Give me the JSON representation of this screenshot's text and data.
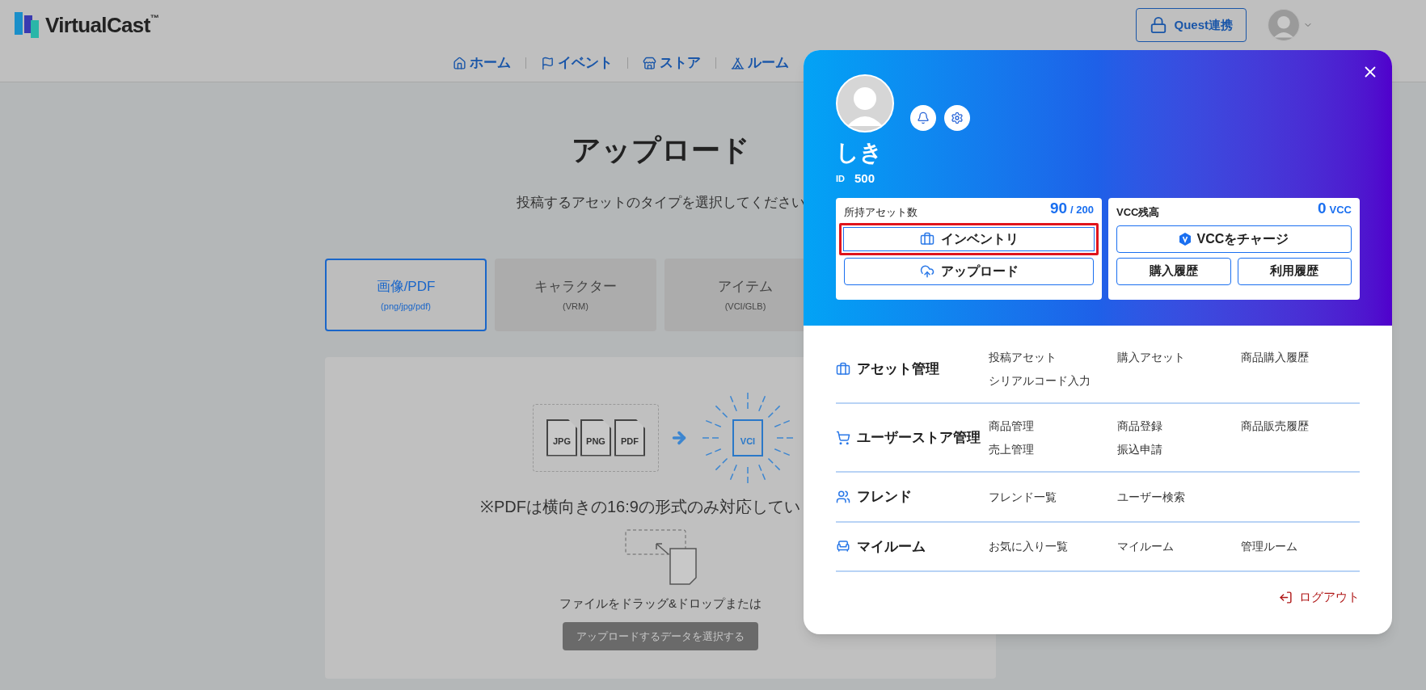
{
  "header": {
    "logo": "VirtualCast",
    "logo_mark": "™",
    "quest_button": "Quest連携",
    "nav": [
      "ホーム",
      "イベント",
      "ストア",
      "ルーム"
    ]
  },
  "page": {
    "title": "アップロード",
    "subtitle": "投稿するアセットのタイプを選択してください",
    "types": [
      {
        "label": "画像/PDF",
        "formats": "(png/jpg/pdf)",
        "selected": true
      },
      {
        "label": "キャラクター",
        "formats": "(VRM)",
        "selected": false
      },
      {
        "label": "アイテム",
        "formats": "(VCI/GLB)",
        "selected": false
      }
    ],
    "files": [
      "JPG",
      "PNG",
      "PDF"
    ],
    "target": "VCI",
    "note": "※PDFは横向きの16:9の形式のみ対応してい",
    "drop_text": "ファイルをドラッグ&ドロップまたは",
    "select_button": "アップロードするデータを選択する"
  },
  "menu": {
    "user_name": "しき",
    "id_label": "ID",
    "id": "500",
    "assets": {
      "label": "所持アセット数",
      "count": "90",
      "limit": "/ 200",
      "buttons": [
        {
          "label": "インベントリ",
          "highlighted": true
        },
        {
          "label": "アップロード",
          "highlighted": false
        }
      ]
    },
    "vcc": {
      "label": "VCC残高",
      "amount": "0",
      "unit": "VCC",
      "charge": "VCCをチャージ",
      "history": [
        "購入履歴",
        "利用履歴"
      ]
    },
    "sections": [
      {
        "title": "アセット管理",
        "links": [
          "投稿アセット",
          "購入アセット",
          "商品購入履歴",
          "シリアルコード入力"
        ]
      },
      {
        "title": "ユーザーストア管理",
        "links": [
          "商品管理",
          "商品登録",
          "商品販売履歴",
          "売上管理",
          "振込申請"
        ]
      },
      {
        "title": "フレンド",
        "links": [
          "フレンド一覧",
          "ユーザー検索"
        ]
      },
      {
        "title": "マイルーム",
        "links": [
          "お気に入り一覧",
          "マイルーム",
          "管理ルーム"
        ]
      }
    ],
    "logout": "ログアウト"
  }
}
